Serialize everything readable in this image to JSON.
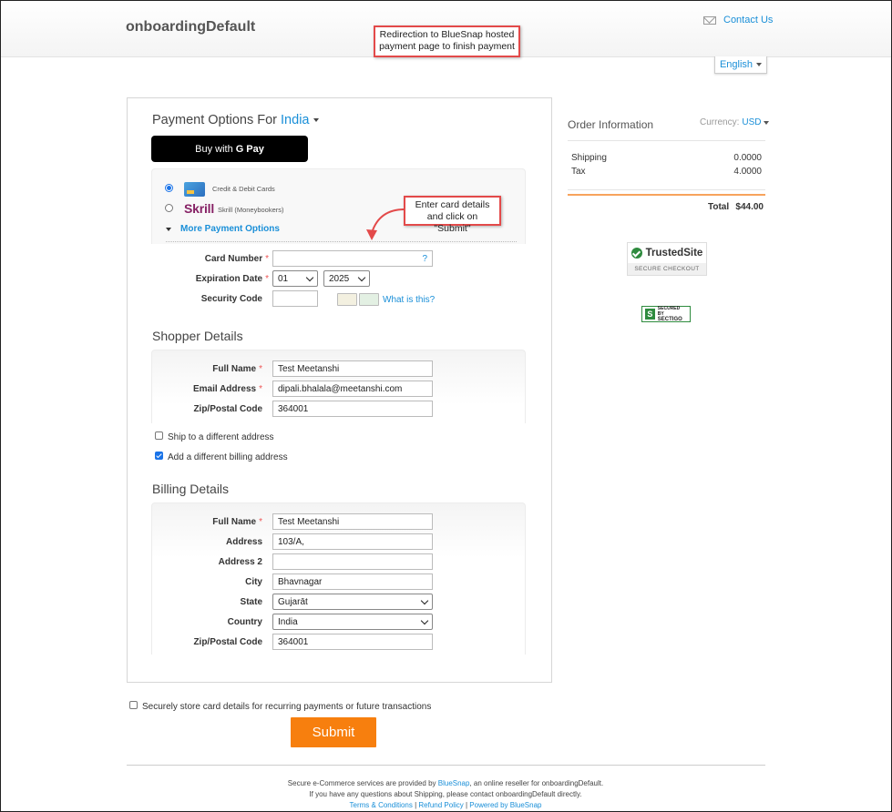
{
  "header": {
    "brand": "onboardingDefault",
    "contact_label": "Contact Us",
    "language": "English"
  },
  "annotations": {
    "redirect_note": "Redirection to BlueSnap hosted payment page to finish payment",
    "card_note": "Enter card details and click on \"Submit\""
  },
  "payment": {
    "title_prefix": "Payment Options For",
    "country": "India",
    "gpay_label": "Buy with",
    "gpay_brand": "G Pay",
    "options": [
      {
        "label": "Credit & Debit Cards",
        "selected": true
      },
      {
        "label": "Skrill (Moneybookers)",
        "brand": "Skrill",
        "selected": false
      }
    ],
    "more_options": "More Payment Options",
    "card_number_label": "Card Number",
    "card_number_value": "",
    "card_help": "?",
    "expiration_label": "Expiration Date",
    "exp_month": "01",
    "exp_year": "2025",
    "security_label": "Security Code",
    "security_value": "",
    "what_is_this": "What is this?"
  },
  "shopper": {
    "title": "Shopper Details",
    "full_name_label": "Full Name",
    "full_name": "Test Meetanshi",
    "email_label": "Email Address",
    "email": "dipali.bhalala@meetanshi.com",
    "zip_label": "Zip/Postal Code",
    "zip": "364001",
    "ship_different": {
      "label": "Ship to a different address",
      "checked": false
    },
    "billing_different": {
      "label": "Add a different billing address",
      "checked": true
    }
  },
  "billing": {
    "title": "Billing Details",
    "full_name_label": "Full Name",
    "full_name": "Test Meetanshi",
    "address_label": "Address",
    "address": "103/A,",
    "address2_label": "Address 2",
    "address2": "",
    "city_label": "City",
    "city": "Bhavnagar",
    "state_label": "State",
    "state": "Gujarāt",
    "country_label": "Country",
    "country": "India",
    "zip_label": "Zip/Postal Code",
    "zip": "364001"
  },
  "store_card": {
    "label": "Securely store card details for recurring payments or future transactions",
    "checked": false
  },
  "submit_label": "Submit",
  "order": {
    "title": "Order Information",
    "currency_label": "Currency:",
    "currency": "USD",
    "rows": [
      {
        "label": "Shipping",
        "value": "0.0000"
      },
      {
        "label": "Tax",
        "value": "4.0000"
      }
    ],
    "total_label": "Total",
    "total_value": "$44.00"
  },
  "badges": {
    "trusted_title": "TrustedSite",
    "trusted_sub": "SECURE CHECKOUT",
    "sectigo_line1": "SECURED BY",
    "sectigo_line2": "SECTIGO"
  },
  "footer": {
    "line1_prefix": "Secure e-Commerce services are provided by",
    "line1_link": "BlueSnap",
    "line1_suffix": ", an online reseller for onboardingDefault.",
    "line2": "If you have any questions about Shipping, please contact onboardingDefault directly.",
    "links": [
      "Terms & Conditions",
      "Refund Policy",
      "Powered by BlueSnap"
    ]
  },
  "colors": {
    "accent": "#1a8fd8",
    "submit": "#f77f0e",
    "annotation": "#e34a4a"
  }
}
